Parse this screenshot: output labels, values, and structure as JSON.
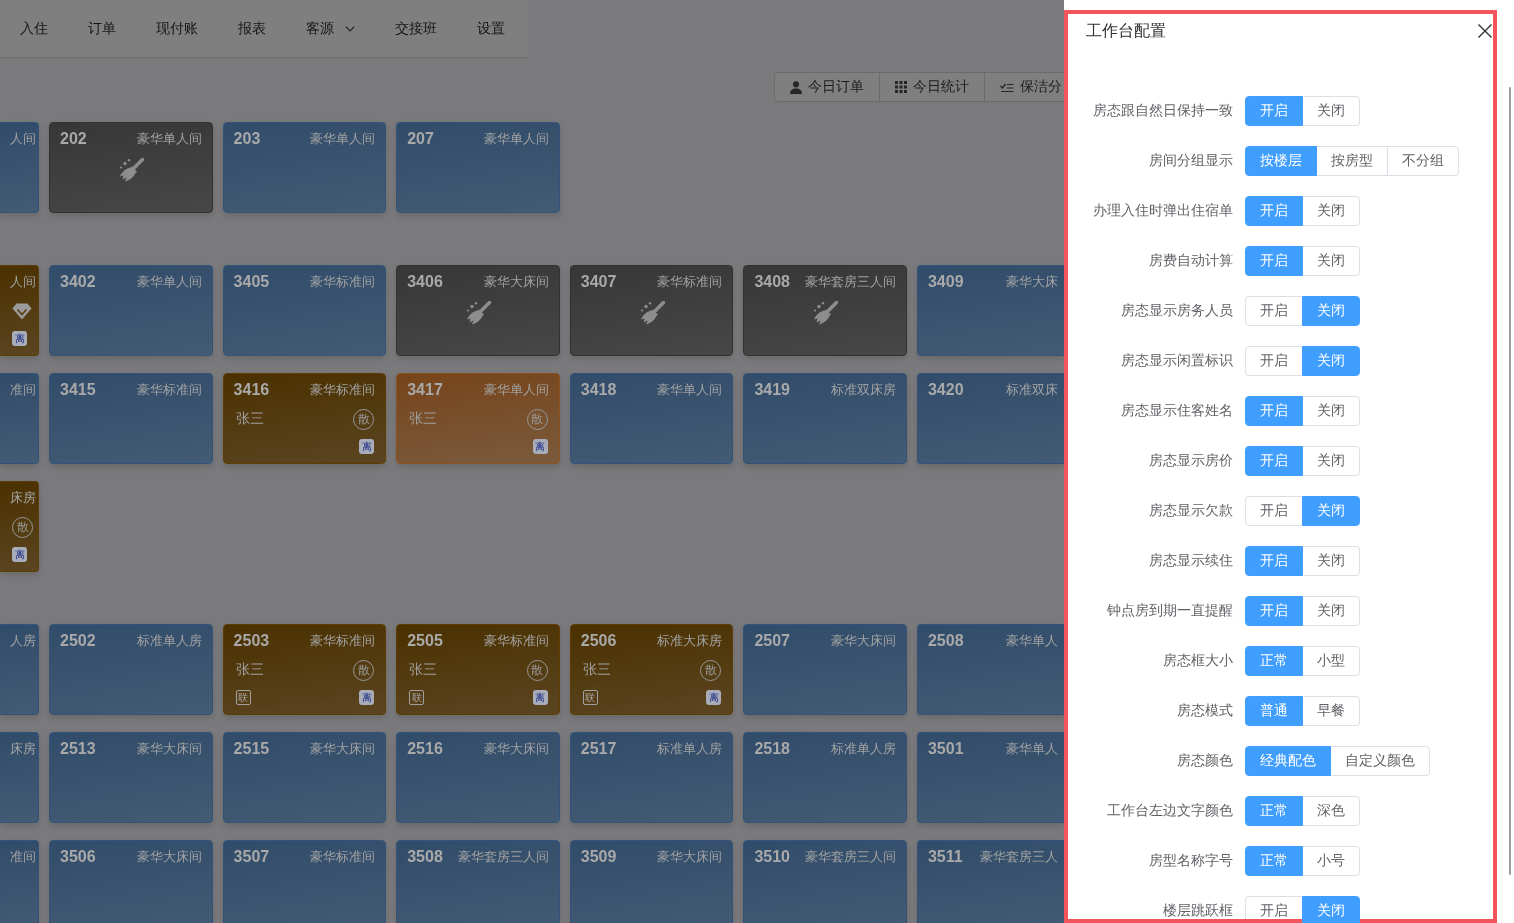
{
  "nav": {
    "items": [
      {
        "label": "入住",
        "has_menu": false
      },
      {
        "label": "订单",
        "has_menu": false
      },
      {
        "label": "现付账",
        "has_menu": false
      },
      {
        "label": "报表",
        "has_menu": false
      },
      {
        "label": "客源",
        "has_menu": true
      },
      {
        "label": "交接班",
        "has_menu": false
      },
      {
        "label": "设置",
        "has_menu": false
      }
    ]
  },
  "toolbar": {
    "buttons": [
      {
        "label": "今日订单"
      },
      {
        "label": "今日统计"
      },
      {
        "label": "保洁分"
      }
    ]
  },
  "room_groups": [
    {
      "rows": [
        {
          "rooms": [
            {
              "type": "人间",
              "kind": "vacant",
              "vip": false
            },
            {
              "number": "202",
              "type": "豪华单人间",
              "kind": "dirty",
              "vip": false
            },
            {
              "number": "203",
              "type": "豪华单人间",
              "kind": "vacant",
              "vip": false
            },
            {
              "number": "207",
              "type": "豪华单人间",
              "kind": "vacant",
              "vip": false
            }
          ]
        }
      ]
    },
    {
      "rows": [
        {
          "rooms": [
            {
              "type": "人间",
              "kind": "occupied",
              "vip": true,
              "checkout": "离"
            },
            {
              "number": "3402",
              "type": "豪华单人间",
              "kind": "vacant",
              "vip": false
            },
            {
              "number": "3405",
              "type": "豪华标准间",
              "kind": "vacant",
              "vip": false
            },
            {
              "number": "3406",
              "type": "豪华大床间",
              "kind": "dirty",
              "vip": false
            },
            {
              "number": "3407",
              "type": "豪华标准间",
              "kind": "dirty",
              "vip": false
            },
            {
              "number": "3408",
              "type": "豪华套房三人间",
              "kind": "dirty",
              "vip": false
            },
            {
              "number": "3409",
              "type": "豪华大床",
              "kind": "vacant",
              "vip": false
            }
          ]
        },
        {
          "rooms": [
            {
              "type": "准间",
              "kind": "vacant",
              "vip": false
            },
            {
              "number": "3415",
              "type": "豪华标准间",
              "kind": "vacant",
              "vip": false
            },
            {
              "number": "3416",
              "type": "豪华标准间",
              "kind": "occupied",
              "vip": false,
              "guest": "张三",
              "source": "散",
              "checkout": "离"
            },
            {
              "number": "3417",
              "type": "豪华单人间",
              "kind": "due_out",
              "vip": false,
              "guest": "张三",
              "source": "散",
              "checkout": "离"
            },
            {
              "number": "3418",
              "type": "豪华单人间",
              "kind": "vacant",
              "vip": false
            },
            {
              "number": "3419",
              "type": "标准双床房",
              "kind": "vacant",
              "vip": false
            },
            {
              "number": "3420",
              "type": "标准双床",
              "kind": "vacant",
              "vip": false
            }
          ]
        },
        {
          "rooms": [
            {
              "type": "床房",
              "kind": "occupied",
              "vip": false,
              "source": "散",
              "checkout": "离"
            }
          ]
        }
      ]
    },
    {
      "rows": [
        {
          "rooms": [
            {
              "type": "人房",
              "kind": "vacant",
              "vip": false
            },
            {
              "number": "2502",
              "type": "标准单人房",
              "kind": "vacant",
              "vip": false
            },
            {
              "number": "2503",
              "type": "豪华标准间",
              "kind": "occupied",
              "vip": false,
              "guest": "张三",
              "source": "散",
              "linked": "联",
              "checkout": "离"
            },
            {
              "number": "2505",
              "type": "豪华标准间",
              "kind": "occupied",
              "vip": false,
              "guest": "张三",
              "source": "散",
              "linked": "联",
              "checkout": "离"
            },
            {
              "number": "2506",
              "type": "标准大床房",
              "kind": "occupied",
              "vip": false,
              "guest": "张三",
              "source": "散",
              "linked": "联",
              "checkout": "离"
            },
            {
              "number": "2507",
              "type": "豪华大床间",
              "kind": "vacant",
              "vip": false
            },
            {
              "number": "2508",
              "type": "豪华单人",
              "kind": "vacant",
              "vip": false
            }
          ]
        },
        {
          "rooms": [
            {
              "type": "床房",
              "kind": "vacant",
              "vip": false
            },
            {
              "number": "2513",
              "type": "豪华大床间",
              "kind": "vacant",
              "vip": false
            },
            {
              "number": "2515",
              "type": "豪华大床间",
              "kind": "vacant",
              "vip": false
            },
            {
              "number": "2516",
              "type": "豪华大床间",
              "kind": "vacant",
              "vip": false
            },
            {
              "number": "2517",
              "type": "标准单人房",
              "kind": "vacant",
              "vip": false
            },
            {
              "number": "2518",
              "type": "标准单人房",
              "kind": "vacant",
              "vip": false
            },
            {
              "number": "3501",
              "type": "豪华单人",
              "kind": "vacant",
              "vip": false
            }
          ]
        },
        {
          "rooms": [
            {
              "type": "准间",
              "kind": "vacant",
              "vip": false
            },
            {
              "number": "3506",
              "type": "豪华大床间",
              "kind": "vacant",
              "vip": false
            },
            {
              "number": "3507",
              "type": "豪华标准间",
              "kind": "vacant",
              "vip": false
            },
            {
              "number": "3508",
              "type": "豪华套房三人间",
              "kind": "vacant",
              "vip": false
            },
            {
              "number": "3509",
              "type": "豪华大床间",
              "kind": "vacant",
              "vip": false
            },
            {
              "number": "3510",
              "type": "豪华套房三人间",
              "kind": "vacant",
              "vip": false
            },
            {
              "number": "3511",
              "type": "豪华套房三人",
              "kind": "vacant",
              "vip": false
            }
          ]
        }
      ]
    }
  ],
  "drawer": {
    "title": "工作台配置",
    "settings": [
      {
        "label": "房态跟自然日保持一致",
        "options": [
          {
            "label": "开启",
            "selected": true
          },
          {
            "label": "关闭",
            "selected": false
          }
        ]
      },
      {
        "label": "房间分组显示",
        "options": [
          {
            "label": "按楼层",
            "selected": true
          },
          {
            "label": "按房型",
            "selected": false
          },
          {
            "label": "不分组",
            "selected": false
          }
        ]
      },
      {
        "label": "办理入住时弹出住宿单",
        "options": [
          {
            "label": "开启",
            "selected": true
          },
          {
            "label": "关闭",
            "selected": false
          }
        ]
      },
      {
        "label": "房费自动计算",
        "options": [
          {
            "label": "开启",
            "selected": true
          },
          {
            "label": "关闭",
            "selected": false
          }
        ]
      },
      {
        "label": "房态显示房务人员",
        "options": [
          {
            "label": "开启",
            "selected": false
          },
          {
            "label": "关闭",
            "selected": true
          }
        ]
      },
      {
        "label": "房态显示闲置标识",
        "options": [
          {
            "label": "开启",
            "selected": false
          },
          {
            "label": "关闭",
            "selected": true
          }
        ]
      },
      {
        "label": "房态显示住客姓名",
        "options": [
          {
            "label": "开启",
            "selected": true
          },
          {
            "label": "关闭",
            "selected": false
          }
        ]
      },
      {
        "label": "房态显示房价",
        "options": [
          {
            "label": "开启",
            "selected": true
          },
          {
            "label": "关闭",
            "selected": false
          }
        ]
      },
      {
        "label": "房态显示欠款",
        "options": [
          {
            "label": "开启",
            "selected": false
          },
          {
            "label": "关闭",
            "selected": true
          }
        ]
      },
      {
        "label": "房态显示续住",
        "options": [
          {
            "label": "开启",
            "selected": true
          },
          {
            "label": "关闭",
            "selected": false
          }
        ]
      },
      {
        "label": "钟点房到期一直提醒",
        "options": [
          {
            "label": "开启",
            "selected": true
          },
          {
            "label": "关闭",
            "selected": false
          }
        ]
      },
      {
        "label": "房态框大小",
        "options": [
          {
            "label": "正常",
            "selected": true
          },
          {
            "label": "小型",
            "selected": false
          }
        ]
      },
      {
        "label": "房态模式",
        "options": [
          {
            "label": "普通",
            "selected": true
          },
          {
            "label": "早餐",
            "selected": false
          }
        ]
      },
      {
        "label": "房态颜色",
        "options": [
          {
            "label": "经典配色",
            "selected": true
          },
          {
            "label": "自定义颜色",
            "selected": false
          }
        ]
      },
      {
        "label": "工作台左边文字颜色",
        "options": [
          {
            "label": "正常",
            "selected": true
          },
          {
            "label": "深色",
            "selected": false
          }
        ]
      },
      {
        "label": "房型名称字号",
        "options": [
          {
            "label": "正常",
            "selected": true
          },
          {
            "label": "小号",
            "selected": false
          }
        ]
      },
      {
        "label": "楼层跳跃框",
        "options": [
          {
            "label": "开启",
            "selected": false
          },
          {
            "label": "关闭",
            "selected": true
          }
        ]
      }
    ]
  }
}
